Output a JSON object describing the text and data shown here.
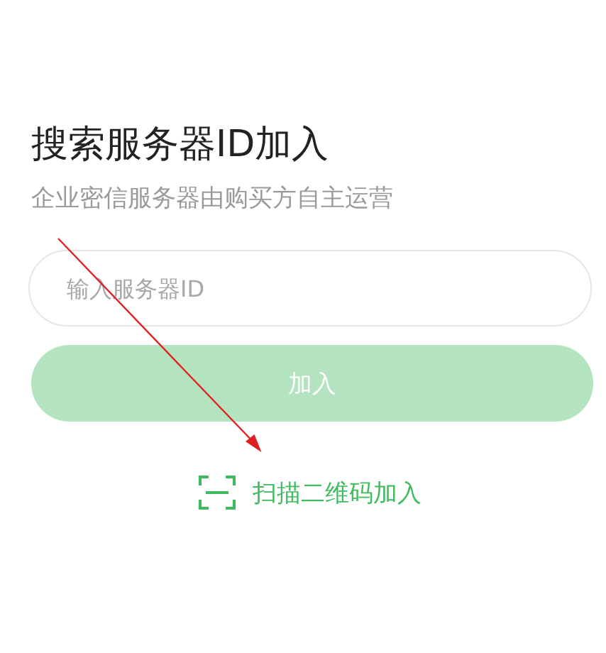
{
  "title": "搜索服务器ID加入",
  "subtitle": "企业密信服务器由购买方自主运营",
  "search": {
    "placeholder": "输入服务器ID"
  },
  "join_button": {
    "label": "加入",
    "disabled": true
  },
  "scan_link": {
    "label": "扫描二维码加入"
  }
}
